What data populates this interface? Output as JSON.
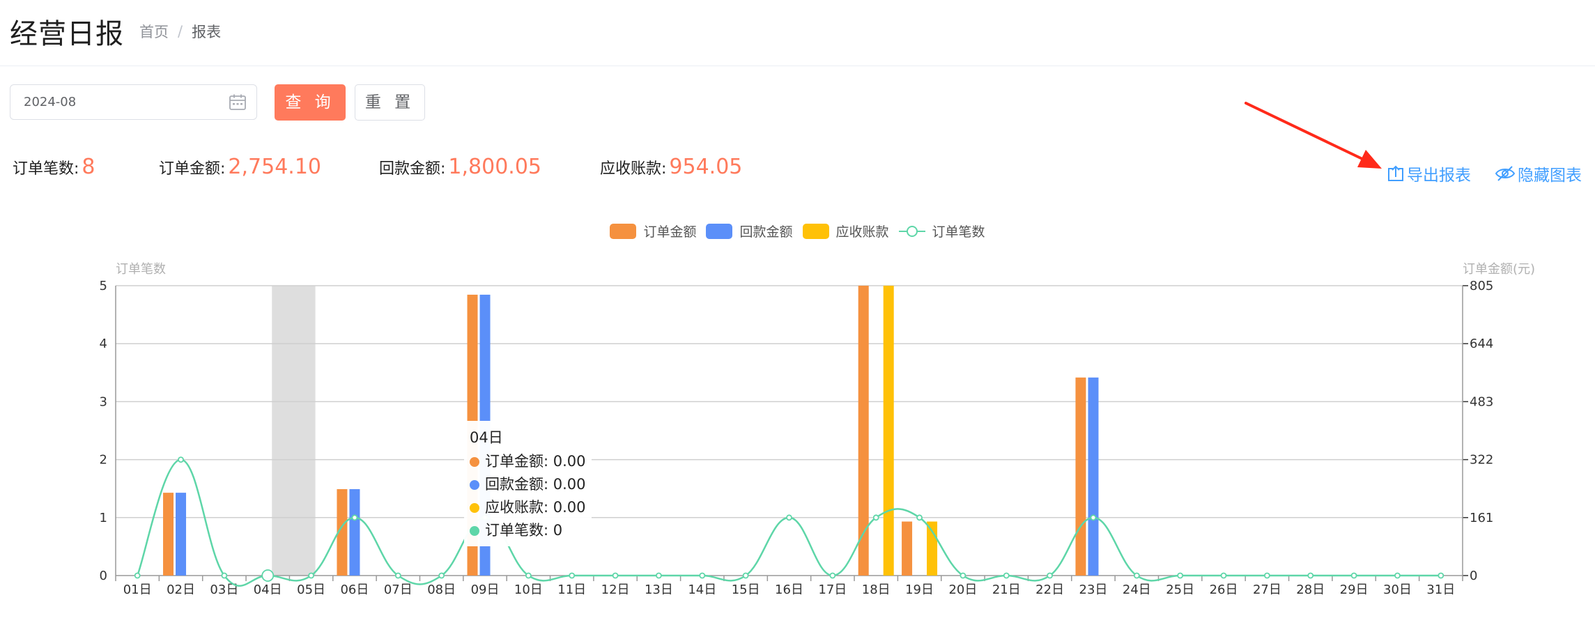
{
  "header": {
    "title": "经营日报",
    "breadcrumb": {
      "home": "首页",
      "separator": "/",
      "current": "报表"
    }
  },
  "filters": {
    "date_value": "2024-08",
    "query_label": "查 询",
    "reset_label": "重 置"
  },
  "summary": [
    {
      "label": "订单笔数:",
      "value": "8"
    },
    {
      "label": "订单金额:",
      "value": "2,754.10"
    },
    {
      "label": "回款金额:",
      "value": "1,800.05"
    },
    {
      "label": "应收账款:",
      "value": "954.05"
    }
  ],
  "actions": {
    "export_label": "导出报表",
    "hide_chart_label": "隐藏图表"
  },
  "colors": {
    "accent": "#ff7a5c",
    "link": "#409eff",
    "arrow": "#ff2a1a",
    "series_order_amount": "#f5913f",
    "series_payment_amount": "#5b8ff9",
    "series_receivable": "#ffc107",
    "series_order_count": "#5ed6a8"
  },
  "chart_data": {
    "type": "bar",
    "title": "",
    "legend": [
      {
        "name": "订单金额",
        "kind": "bar",
        "color": "#f5913f"
      },
      {
        "name": "回款金额",
        "kind": "bar",
        "color": "#5b8ff9"
      },
      {
        "name": "应收账款",
        "kind": "bar",
        "color": "#ffc107"
      },
      {
        "name": "订单笔数",
        "kind": "line",
        "color": "#5ed6a8"
      }
    ],
    "legend_position": "top-center",
    "y_left_title": "订单笔数",
    "y_right_title": "订单金额(元)",
    "y_left_ticks": [
      "0",
      "1",
      "2",
      "3",
      "4",
      "5"
    ],
    "y_right_ticks": [
      "0",
      "161",
      "322",
      "483",
      "644",
      "805"
    ],
    "y_left_range": [
      0,
      5
    ],
    "y_right_range": [
      0,
      805
    ],
    "grid": true,
    "categories": [
      "01日",
      "02日",
      "03日",
      "04日",
      "05日",
      "06日",
      "07日",
      "08日",
      "09日",
      "10日",
      "11日",
      "12日",
      "13日",
      "14日",
      "15日",
      "16日",
      "17日",
      "18日",
      "19日",
      "20日",
      "21日",
      "22日",
      "23日",
      "24日",
      "25日",
      "26日",
      "27日",
      "28日",
      "29日",
      "30日",
      "31日"
    ],
    "series": [
      {
        "name": "订单金额",
        "axis": "right",
        "values": [
          0,
          230,
          0,
          0,
          0,
          240,
          0,
          0,
          780,
          0,
          0,
          0,
          0,
          0,
          0,
          0,
          0,
          805,
          150,
          0,
          0,
          0,
          550,
          0,
          0,
          0,
          0,
          0,
          0,
          0,
          0
        ]
      },
      {
        "name": "回款金额",
        "axis": "right",
        "values": [
          0,
          230,
          0,
          0,
          0,
          240,
          0,
          0,
          780,
          0,
          0,
          0,
          0,
          0,
          0,
          0,
          0,
          0,
          0,
          0,
          0,
          0,
          550,
          0,
          0,
          0,
          0,
          0,
          0,
          0,
          0
        ]
      },
      {
        "name": "应收账款",
        "axis": "right",
        "values": [
          0,
          0,
          0,
          0,
          0,
          0,
          0,
          0,
          0,
          0,
          0,
          0,
          0,
          0,
          0,
          0,
          0,
          805,
          150,
          0,
          0,
          0,
          0,
          0,
          0,
          0,
          0,
          0,
          0,
          0,
          0
        ]
      },
      {
        "name": "订单笔数",
        "axis": "left",
        "type": "line",
        "values": [
          0,
          2,
          0,
          0,
          0,
          1,
          0,
          0,
          1,
          0,
          0,
          0,
          0,
          0,
          0,
          1,
          0,
          1,
          1,
          0,
          0,
          0,
          1,
          0,
          0,
          0,
          0,
          0,
          0,
          0,
          0
        ]
      }
    ],
    "highlighted_category": "04日",
    "tooltip": {
      "title": "04日",
      "rows": [
        {
          "label": "订单金额: 0.00",
          "color": "#f5913f"
        },
        {
          "label": "回款金额: 0.00",
          "color": "#5b8ff9"
        },
        {
          "label": "应收账款: 0.00",
          "color": "#ffc107"
        },
        {
          "label": "订单笔数: 0",
          "color": "#5ed6a8"
        }
      ]
    }
  }
}
